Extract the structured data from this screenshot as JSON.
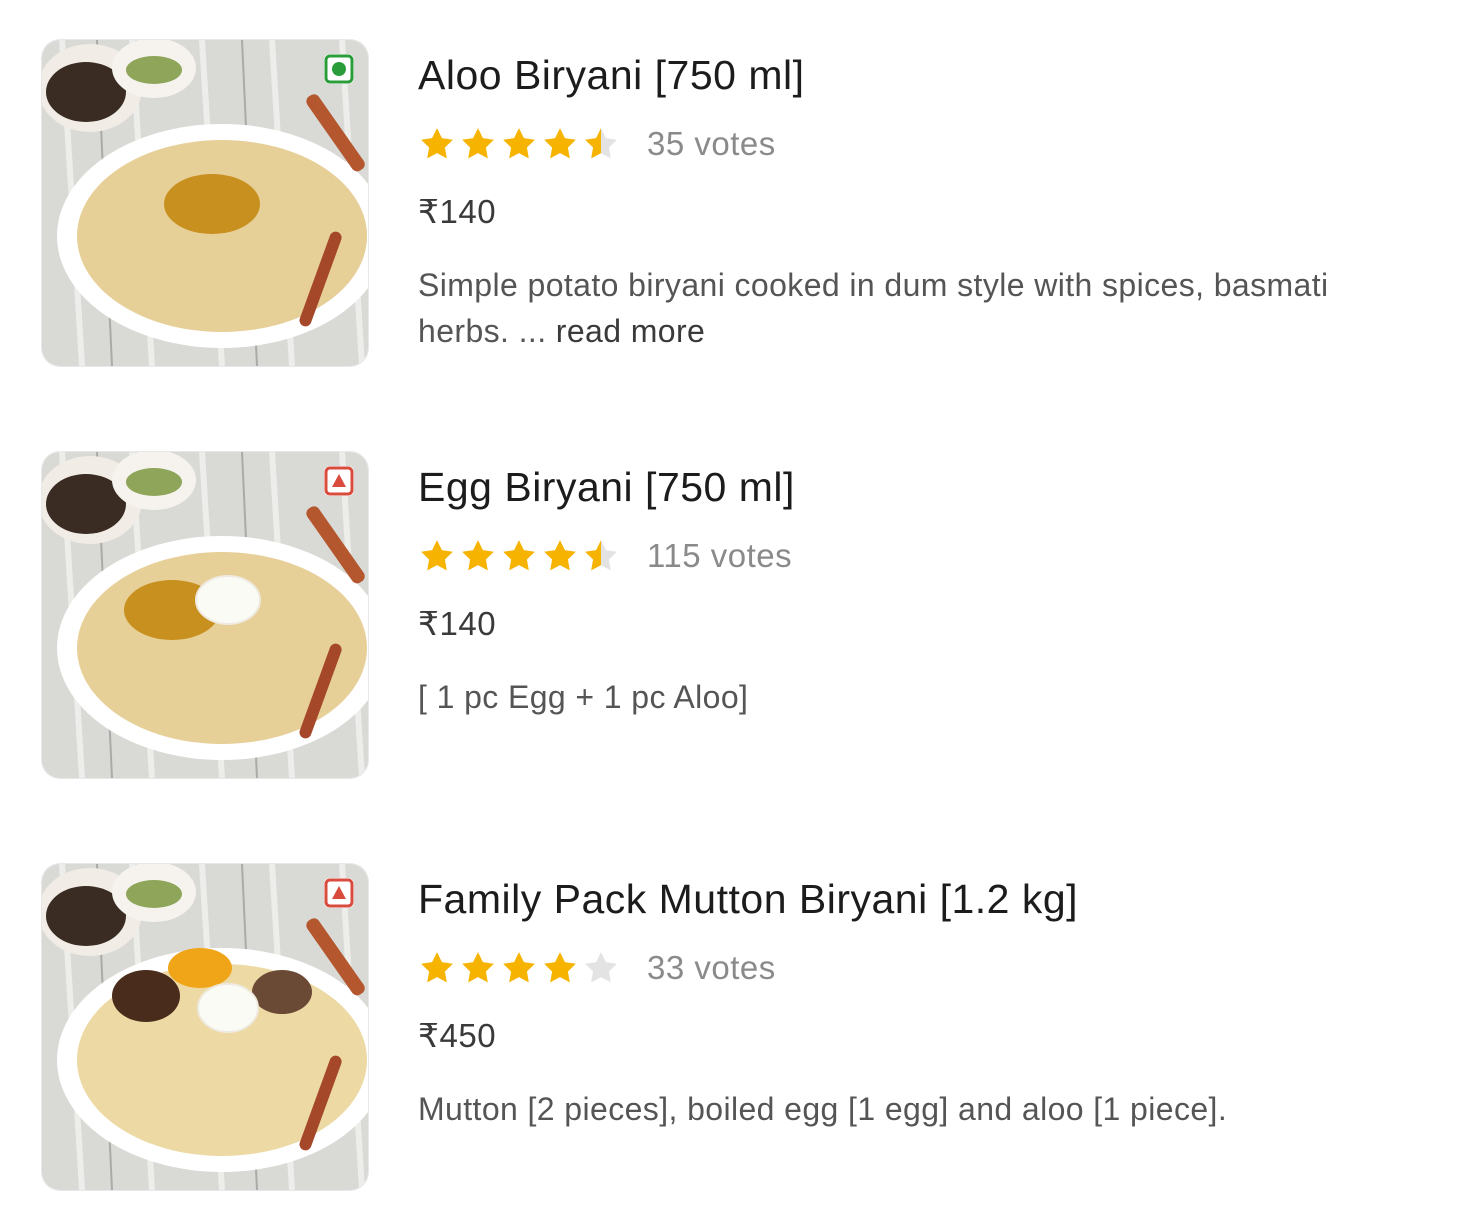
{
  "colors": {
    "star_filled": "#f6b400",
    "star_empty": "#e3e3e3",
    "veg": "#2a9d3a",
    "nonveg": "#d94b3c"
  },
  "items": [
    {
      "name": "Aloo Biryani [750 ml]",
      "diet": "veg",
      "diet_icon": "veg-icon",
      "rating": 4.5,
      "votes": "35 votes",
      "price": "₹140",
      "description": "Simple potato biryani cooked in dum style with spices, basmati",
      "description_line2": "herbs. ...",
      "read_more": "read more",
      "image_icon": "aloo-biryani-image"
    },
    {
      "name": "Egg Biryani [750 ml]",
      "diet": "nonveg",
      "diet_icon": "non-veg-icon",
      "rating": 4.5,
      "votes": "115 votes",
      "price": "₹140",
      "description": "[ 1 pc Egg + 1 pc Aloo]",
      "image_icon": "egg-biryani-image"
    },
    {
      "name": "Family Pack Mutton Biryani [1.2 kg]",
      "diet": "nonveg",
      "diet_icon": "non-veg-icon",
      "rating": 4,
      "votes": "33 votes",
      "price": "₹450",
      "description": "Mutton [2 pieces], boiled egg [1 egg] and aloo [1 piece].",
      "image_icon": "mutton-biryani-image"
    }
  ]
}
